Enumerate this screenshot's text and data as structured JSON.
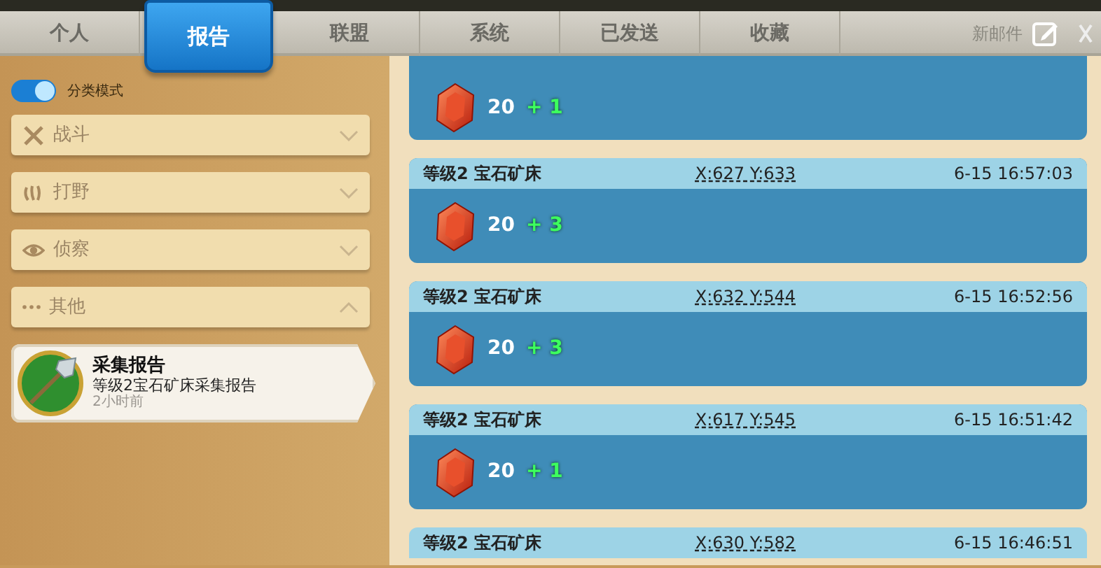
{
  "tabs": [
    {
      "label": "个人",
      "selected": false
    },
    {
      "label": "报告",
      "selected": true
    },
    {
      "label": "联盟",
      "selected": false
    },
    {
      "label": "系统",
      "selected": false
    },
    {
      "label": "已发送",
      "selected": false
    },
    {
      "label": "收藏",
      "selected": false
    }
  ],
  "new_mail": {
    "label": "新邮件"
  },
  "sidebar": {
    "toggle": {
      "label": "分类模式",
      "on": true
    },
    "categories": [
      {
        "kind": "battle",
        "label": "战斗",
        "expanded": false
      },
      {
        "kind": "wild",
        "label": "打野",
        "expanded": false
      },
      {
        "kind": "scout",
        "label": "侦察",
        "expanded": false
      },
      {
        "kind": "other",
        "label": "其他",
        "expanded": true
      }
    ],
    "reports": [
      {
        "title": "采集报告",
        "subtitle": "等级2宝石矿床采集报告",
        "time": "2小时前",
        "selected": true
      }
    ]
  },
  "entries": [
    {
      "amount": "20",
      "bonus": "+ 1"
    },
    {
      "title": "等级2 宝石矿床",
      "coords": "X:627 Y:633",
      "time": "6-15 16:57:03",
      "amount": "20",
      "bonus": "+ 3"
    },
    {
      "title": "等级2 宝石矿床",
      "coords": "X:632 Y:544",
      "time": "6-15 16:52:56",
      "amount": "20",
      "bonus": "+ 3"
    },
    {
      "title": "等级2 宝石矿床",
      "coords": "X:617 Y:545",
      "time": "6-15 16:51:42",
      "amount": "20",
      "bonus": "+ 1"
    },
    {
      "title": "等级2 宝石矿床",
      "coords": "X:630 Y:582",
      "time": "6-15 16:46:51"
    }
  ]
}
